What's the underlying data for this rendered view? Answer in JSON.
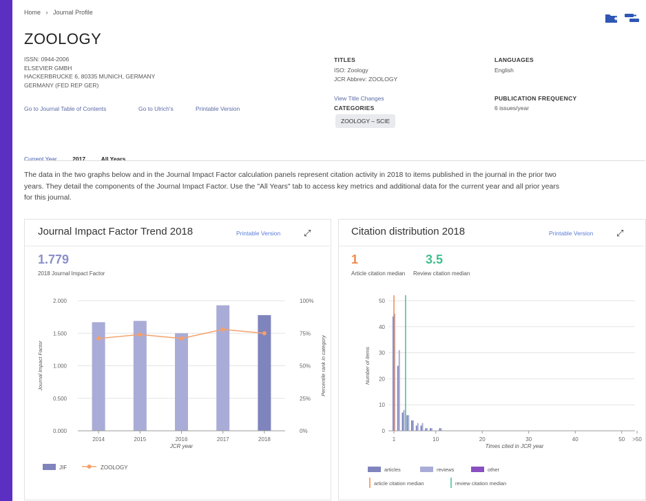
{
  "breadcrumb": {
    "home": "Home",
    "sep": "›",
    "current": "Journal Profile"
  },
  "journal": {
    "title": "ZOOLOGY",
    "issn": "ISSN: 0944-2006",
    "publisher": "ELSEVIER GMBH",
    "address": "HACKERBRUCKE 6, 80335 MUNICH, GERMANY",
    "country": "GERMANY (FED REP GER)",
    "links": [
      "Go to Journal Table of Contents",
      "Go to Ulrich's",
      "Printable Version"
    ]
  },
  "titles": {
    "heading": "TITLES",
    "iso": "ISO: Zoology",
    "jcr": "JCR Abbrev: ZOOLOGY",
    "changes_link": "View Title Changes"
  },
  "categories": {
    "heading": "CATEGORIES",
    "chip": "ZOOLOGY – SCIE"
  },
  "languages": {
    "heading": "LANGUAGES",
    "value": "English"
  },
  "frequency": {
    "heading": "PUBLICATION FREQUENCY",
    "value": "6 issues/year"
  },
  "tabs": [
    "Current Year",
    "2017",
    "All Years"
  ],
  "description": {
    "line1": "The data in the two graphs below and in the Journal Impact Factor calculation panels represent citation activity in 2018 to items published in the journal in the prior two",
    "line2": "years. They detail the components of the Journal Impact Factor. Use the \"All Years\" tab to access key metrics and additional data for the current year and all prior years",
    "line3": "for this journal."
  },
  "jif_card": {
    "title": "Journal Impact Factor Trend 2018",
    "printable": "Printable Version",
    "value": "1.779",
    "value_label": "2018 Journal Impact Factor",
    "accent": "#8b8fc8",
    "legend": {
      "jif": "JIF",
      "zoology": "ZOOLOGY"
    }
  },
  "cit_card": {
    "title": "Citation distribution 2018",
    "printable": "Printable Version",
    "article_median": "1",
    "article_label": "Article citation median",
    "review_median": "3.5",
    "review_label": "Review citation median",
    "article_color": "#f08a4b",
    "review_color": "#3fbf8f",
    "legend": {
      "articles": "articles",
      "reviews": "reviews",
      "other": "other",
      "article_median": "article citation median",
      "review_median": "review citation median"
    }
  },
  "chart_data": [
    {
      "type": "bar",
      "title": "Journal Impact Factor Trend 2018",
      "xlabel": "JCR year",
      "ylabel": "Journal Impact Factor",
      "y2label": "Percentile rank in category",
      "categories": [
        "2014",
        "2015",
        "2016",
        "2017",
        "2018"
      ],
      "yticks": [
        "0.000",
        "0.500",
        "1.000",
        "1.500",
        "2.000"
      ],
      "y2ticks": [
        "0%",
        "25%",
        "50%",
        "75%",
        "100%"
      ],
      "ylim": [
        0,
        2
      ],
      "y2lim": [
        0,
        100
      ],
      "series": [
        {
          "name": "JIF",
          "type": "bar",
          "values": [
            1.67,
            1.69,
            1.5,
            1.93,
            1.779
          ],
          "colors": [
            "#a9acd6",
            "#a9acd6",
            "#a9acd6",
            "#a9acd6",
            "#7f84bd"
          ]
        },
        {
          "name": "ZOOLOGY",
          "type": "line",
          "axis": "y2",
          "color": "#f5a06a",
          "values": [
            71,
            74,
            71,
            78,
            75
          ]
        }
      ],
      "legend": "bottom-left",
      "grid": true
    },
    {
      "type": "bar",
      "title": "Citation distribution 2018",
      "xlabel": "Times cited in JCR year",
      "ylabel": "Number of items",
      "xticks": [
        "1",
        "10",
        "20",
        "30",
        "40",
        "50",
        ">50"
      ],
      "yticks": [
        "0",
        "10",
        "20",
        "30",
        "40",
        "50"
      ],
      "ylim": [
        0,
        50
      ],
      "series": [
        {
          "name": "articles",
          "color": "#7f84bd",
          "x": [
            1,
            2,
            3,
            4,
            5,
            6,
            7,
            8,
            9,
            11
          ],
          "values": [
            44,
            25,
            7,
            6,
            4,
            2,
            2,
            1,
            1,
            1
          ]
        },
        {
          "name": "reviews",
          "color": "#a9acd6",
          "x": [
            1,
            2,
            3,
            4,
            5,
            6,
            7,
            8,
            9,
            11
          ],
          "values": [
            45,
            31,
            8,
            6,
            4,
            3,
            3,
            1,
            1,
            1
          ]
        },
        {
          "name": "other",
          "color": "#8a4fc0",
          "x": [],
          "values": []
        }
      ],
      "medians": {
        "article citation median": 1,
        "review citation median": 3.5
      },
      "legend": "bottom-left",
      "grid": true
    }
  ]
}
